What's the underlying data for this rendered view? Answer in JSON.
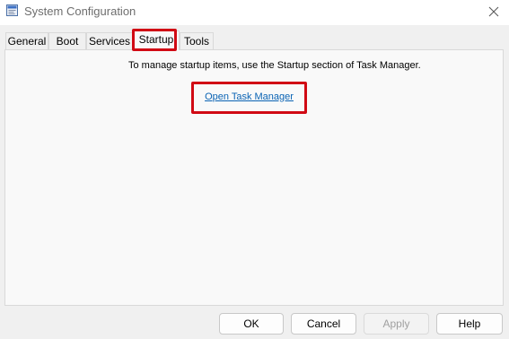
{
  "window": {
    "title": "System Configuration",
    "app_icon": "msconfig-icon",
    "close_icon": "close-icon"
  },
  "tabs": [
    {
      "label": "General",
      "active": false
    },
    {
      "label": "Boot",
      "active": false
    },
    {
      "label": "Services",
      "active": false
    },
    {
      "label": "Startup",
      "active": true
    },
    {
      "label": "Tools",
      "active": false
    }
  ],
  "startup_panel": {
    "info_text": "To manage startup items, use the Startup section of Task Manager.",
    "link_text": "Open Task Manager"
  },
  "buttons": {
    "ok": "OK",
    "cancel": "Cancel",
    "apply": "Apply",
    "help": "Help"
  },
  "colors": {
    "highlight": "#d10a14",
    "link": "#0a63b4",
    "disabled_text": "#a0a0a0"
  }
}
